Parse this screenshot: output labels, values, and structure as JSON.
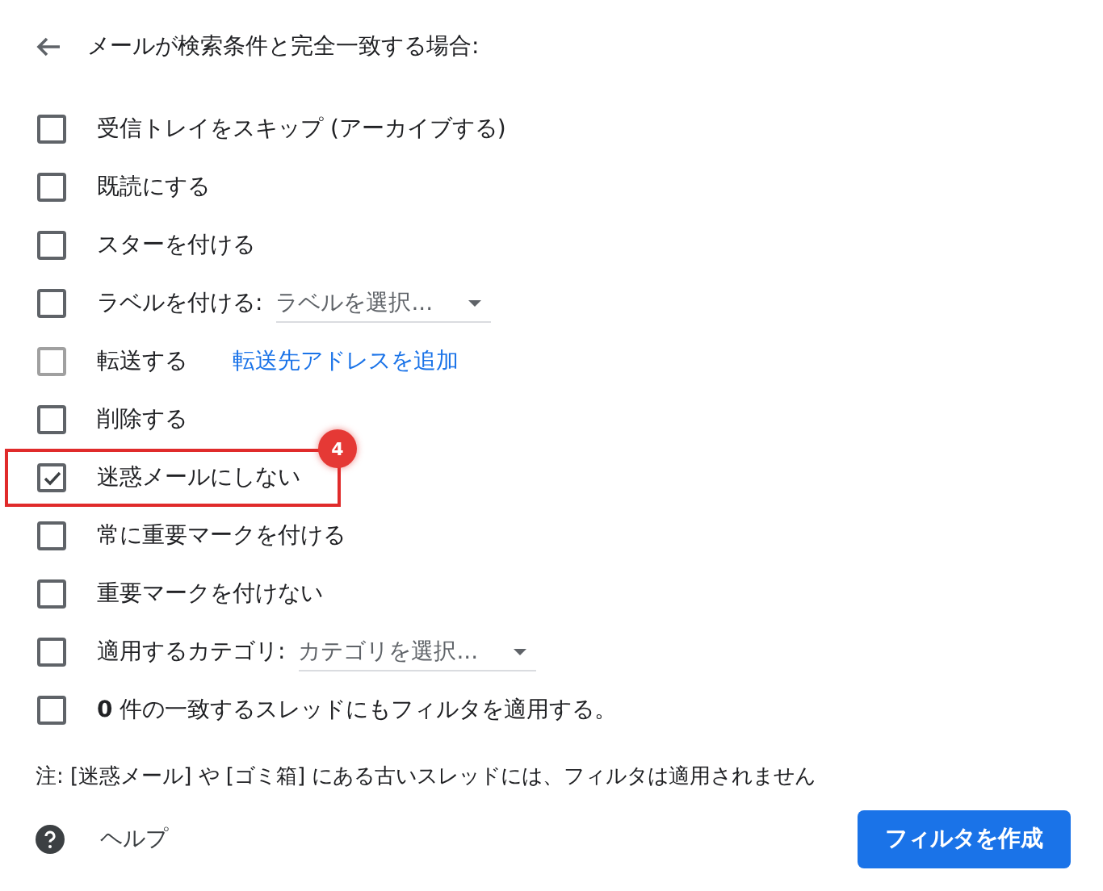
{
  "header": {
    "title": "メールが検索条件と完全一致する場合:"
  },
  "actions": [
    {
      "kind": "plain",
      "label": "受信トレイをスキップ (アーカイブする)",
      "checked": false,
      "disabled": false,
      "highlighted": false
    },
    {
      "kind": "plain",
      "label": "既読にする",
      "checked": false,
      "disabled": false,
      "highlighted": false
    },
    {
      "kind": "plain",
      "label": "スターを付ける",
      "checked": false,
      "disabled": false,
      "highlighted": false
    },
    {
      "kind": "select",
      "label": "ラベルを付ける:",
      "select": "ラベルを選択...",
      "checked": false,
      "disabled": false,
      "highlighted": false
    },
    {
      "kind": "link",
      "label": "転送する",
      "link": "転送先アドレスを追加",
      "checked": false,
      "disabled": true,
      "highlighted": false
    },
    {
      "kind": "plain",
      "label": "削除する",
      "checked": false,
      "disabled": false,
      "highlighted": false
    },
    {
      "kind": "plain",
      "label": "迷惑メールにしない",
      "checked": true,
      "disabled": false,
      "highlighted": true,
      "badge": "4"
    },
    {
      "kind": "plain",
      "label": "常に重要マークを付ける",
      "checked": false,
      "disabled": false,
      "highlighted": false
    },
    {
      "kind": "plain",
      "label": "重要マークを付けない",
      "checked": false,
      "disabled": false,
      "highlighted": false
    },
    {
      "kind": "select",
      "label": "適用するカテゴリ:",
      "select": "カテゴリを選択...",
      "checked": false,
      "disabled": false,
      "highlighted": false
    },
    {
      "kind": "plain",
      "label": "**0** 件の一致するスレッドにもフィルタを適用する。",
      "checked": false,
      "disabled": false,
      "highlighted": false
    }
  ],
  "note": "注: [迷惑メール] や [ゴミ箱] にある古いスレッドには、フィルタは適用されません",
  "footer": {
    "help": "ヘルプ",
    "create_button": "フィルタを作成"
  }
}
